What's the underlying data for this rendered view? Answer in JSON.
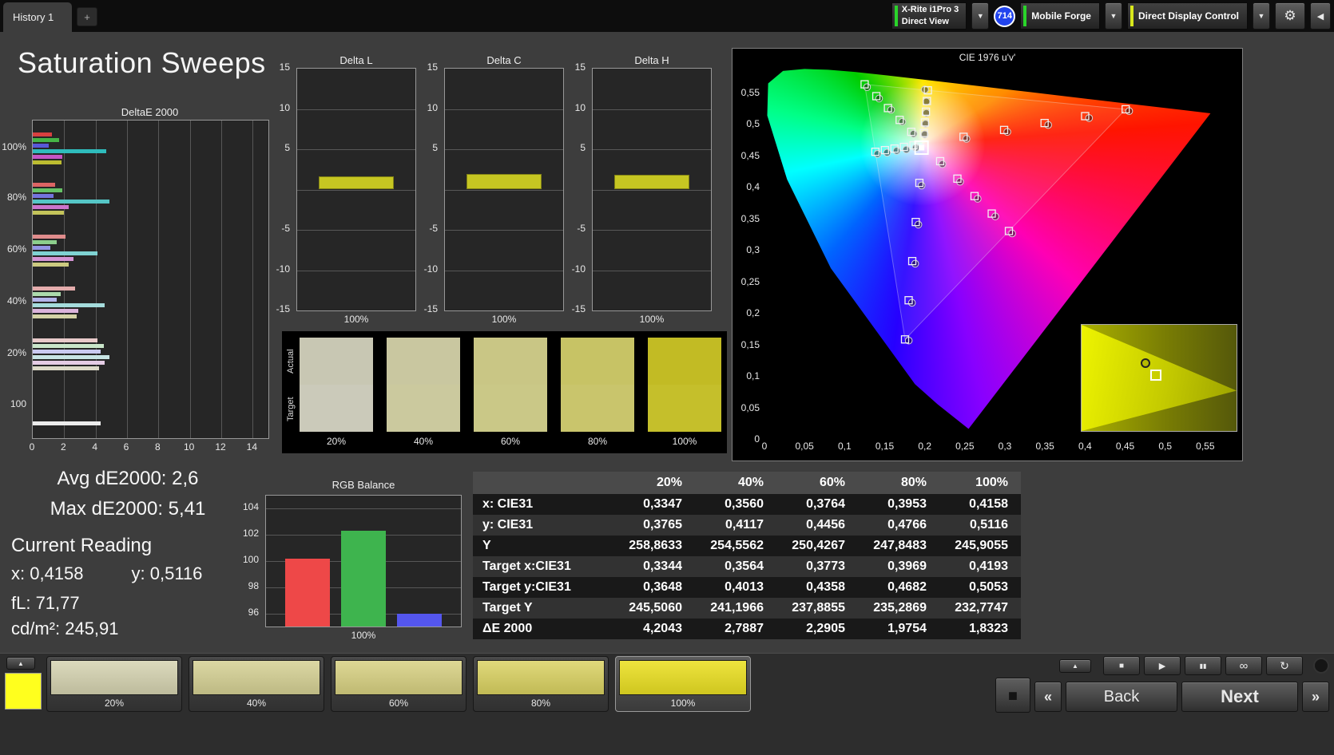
{
  "top_bar": {
    "tab_label": "History 1",
    "add_tab_label": "+",
    "dropdown_icon": "▼",
    "gear_icon": "⚙",
    "collapse_icon": "◀",
    "badge": "714",
    "meter_widget": {
      "line1": "X-Rite i1Pro 3",
      "line2": "Direct View",
      "accent": "#2ad42a"
    },
    "source_widget": {
      "label": "Mobile Forge",
      "accent": "#2ad42a"
    },
    "display_widget": {
      "label": "Direct Display Control",
      "accent": "#d8e81c"
    }
  },
  "page": {
    "title": "Saturation Sweeps"
  },
  "stats": {
    "avg": "Avg dE2000: 2,6",
    "max": "Max dE2000: 5,41",
    "current_heading": "Current Reading",
    "x": "x: 0,4158",
    "y": "y: 0,5116",
    "fl": "fL: 71,77",
    "cd": "cd/m²: 245,91"
  },
  "chart_data": {
    "deltae2000": {
      "type": "bar",
      "title": "DeltaE 2000",
      "orientation": "horizontal",
      "xlim": [
        0,
        15
      ],
      "xticks": [
        0,
        2,
        4,
        6,
        8,
        10,
        12,
        14
      ],
      "groups": [
        {
          "label": "100%",
          "bars": [
            [
              1.2,
              "#d84040"
            ],
            [
              1.7,
              "#46b446"
            ],
            [
              1.0,
              "#5858d8"
            ],
            [
              4.7,
              "#2fbcbc"
            ],
            [
              1.9,
              "#c455c4"
            ],
            [
              1.83,
              "#bcbc30"
            ]
          ]
        },
        {
          "label": "80%",
          "bars": [
            [
              1.4,
              "#dc6464"
            ],
            [
              1.9,
              "#66c266"
            ],
            [
              1.3,
              "#7474de"
            ],
            [
              4.9,
              "#55c6c6"
            ],
            [
              2.3,
              "#cc74cc"
            ],
            [
              1.98,
              "#c4c45a"
            ]
          ]
        },
        {
          "label": "60%",
          "bars": [
            [
              2.1,
              "#e08c8c"
            ],
            [
              1.5,
              "#8cce8c"
            ],
            [
              1.1,
              "#9494e4"
            ],
            [
              4.1,
              "#7fd2d2"
            ],
            [
              2.6,
              "#d494d4"
            ],
            [
              2.29,
              "#ccca80"
            ]
          ]
        },
        {
          "label": "40%",
          "bars": [
            [
              2.7,
              "#e4acac"
            ],
            [
              1.8,
              "#acdaac"
            ],
            [
              1.5,
              "#b4b4ea"
            ],
            [
              4.6,
              "#a5dcdc"
            ],
            [
              2.9,
              "#dcb4dc"
            ],
            [
              2.79,
              "#d4d2a6"
            ]
          ]
        },
        {
          "label": "20%",
          "bars": [
            [
              4.1,
              "#e8caca"
            ],
            [
              4.5,
              "#cae6ca"
            ],
            [
              4.3,
              "#cacaf0"
            ],
            [
              4.9,
              "#c8e4e4"
            ],
            [
              4.6,
              "#e4cce4"
            ],
            [
              4.2,
              "#dcdac8"
            ]
          ]
        },
        {
          "label": "100",
          "bars": [
            [
              4.3,
              "#ececec"
            ]
          ]
        }
      ]
    },
    "delta_l": {
      "type": "bar",
      "title": "Delta L",
      "categories": [
        "100%"
      ],
      "values": [
        1.6
      ],
      "color": "#c6c622",
      "ylim": [
        -15,
        15
      ],
      "yticks": [
        15,
        10,
        5,
        -5,
        -10,
        -15
      ],
      "xlabel": "100%"
    },
    "delta_c": {
      "type": "bar",
      "title": "Delta C",
      "categories": [
        "100%"
      ],
      "values": [
        1.9
      ],
      "color": "#c6c622",
      "ylim": [
        -15,
        15
      ],
      "yticks": [
        15,
        10,
        5,
        -5,
        -10,
        -15
      ],
      "xlabel": "100%"
    },
    "delta_h": {
      "type": "bar",
      "title": "Delta H",
      "categories": [
        "100%"
      ],
      "values": [
        1.8
      ],
      "color": "#c6c622",
      "ylim": [
        -15,
        15
      ],
      "yticks": [
        15,
        10,
        5,
        -5,
        -10,
        -15
      ],
      "xlabel": "100%"
    },
    "swatches": {
      "row_labels": [
        "Actual",
        "Target"
      ],
      "labels": [
        "20%",
        "40%",
        "60%",
        "80%",
        "100%"
      ],
      "actual": [
        "#c8c7b3",
        "#c9c7a0",
        "#c9c685",
        "#c7c365",
        "#c2bb24"
      ],
      "target": [
        "#cbcaba",
        "#cbc99e",
        "#cac887",
        "#c9c56c",
        "#c5bf2b"
      ]
    },
    "cie": {
      "type": "scatter",
      "title": "CIE 1976 u'v'",
      "ticks": [
        "0",
        "0,05",
        "0,1",
        "0,15",
        "0,2",
        "0,25",
        "0,3",
        "0,35",
        "0,4",
        "0,45",
        "0,5",
        "0,55"
      ],
      "tick_step": 0.05,
      "xlim": [
        0,
        0.588
      ],
      "ylim": [
        0,
        0.6
      ],
      "white_point": [
        0.1978,
        0.4683
      ],
      "gamut_triangle": [
        [
          0.4507,
          0.5229
        ],
        [
          0.125,
          0.5625
        ],
        [
          0.1754,
          0.1579
        ]
      ],
      "locus": [
        [
          0.5565,
          0.5165
        ],
        [
          0.52,
          0.522
        ],
        [
          0.4035,
          0.5393
        ],
        [
          0.3315,
          0.5501
        ],
        [
          0.2623,
          0.5604
        ],
        [
          0.2026,
          0.5693
        ],
        [
          0.1531,
          0.5766
        ],
        [
          0.1127,
          0.5821
        ],
        [
          0.0792,
          0.5856
        ],
        [
          0.05,
          0.5868
        ],
        [
          0.0231,
          0.5837
        ],
        [
          0.0046,
          0.5639
        ],
        [
          0.0035,
          0.5131
        ],
        [
          0.0282,
          0.4117
        ],
        [
          0.0828,
          0.2708
        ],
        [
          0.1877,
          0.0871
        ],
        [
          0.2161,
          0.0549
        ],
        [
          0.2546,
          0.0159
        ]
      ],
      "sweeps": [
        {
          "name": "red",
          "targets": [
            [
              0.2484,
              0.4792
            ],
            [
              0.299,
              0.4901
            ],
            [
              0.3495,
              0.5011
            ],
            [
              0.4001,
              0.512
            ],
            [
              0.4507,
              0.5229
            ]
          ],
          "measured": [
            [
              0.252,
              0.476
            ],
            [
              0.303,
              0.487
            ],
            [
              0.354,
              0.498
            ],
            [
              0.405,
              0.509
            ],
            [
              0.455,
              0.52
            ]
          ]
        },
        {
          "name": "green",
          "targets": [
            [
              0.1832,
              0.4871
            ],
            [
              0.1687,
              0.506
            ],
            [
              0.1541,
              0.5248
            ],
            [
              0.1396,
              0.5437
            ],
            [
              0.125,
              0.5625
            ]
          ],
          "measured": [
            [
              0.186,
              0.484
            ],
            [
              0.172,
              0.503
            ],
            [
              0.158,
              0.522
            ],
            [
              0.143,
              0.54
            ],
            [
              0.128,
              0.558
            ]
          ]
        },
        {
          "name": "blue",
          "targets": [
            [
              0.1933,
              0.4062
            ],
            [
              0.1888,
              0.3441
            ],
            [
              0.1844,
              0.2821
            ],
            [
              0.1799,
              0.22
            ],
            [
              0.1754,
              0.1579
            ]
          ],
          "measured": [
            [
              0.196,
              0.402
            ],
            [
              0.192,
              0.34
            ],
            [
              0.188,
              0.278
            ],
            [
              0.184,
              0.216
            ],
            [
              0.18,
              0.156
            ]
          ]
        },
        {
          "name": "cyan",
          "targets": [
            [
              0.1859,
              0.4657
            ],
            [
              0.174,
              0.4632
            ],
            [
              0.1622,
              0.4606
            ],
            [
              0.1503,
              0.4581
            ],
            [
              0.1384,
              0.4555
            ]
          ],
          "measured": [
            [
              0.189,
              0.462
            ],
            [
              0.177,
              0.459
            ],
            [
              0.165,
              0.457
            ],
            [
              0.153,
              0.454
            ],
            [
              0.141,
              0.452
            ]
          ]
        },
        {
          "name": "magenta",
          "targets": [
            [
              0.2192,
              0.4406
            ],
            [
              0.2407,
              0.4129
            ],
            [
              0.2621,
              0.3852
            ],
            [
              0.2836,
              0.3575
            ],
            [
              0.305,
              0.3298
            ]
          ],
          "measured": [
            [
              0.222,
              0.436
            ],
            [
              0.244,
              0.408
            ],
            [
              0.266,
              0.381
            ],
            [
              0.288,
              0.353
            ],
            [
              0.309,
              0.326
            ]
          ]
        },
        {
          "name": "yellow",
          "targets": [
            [
              0.199,
              0.4852
            ],
            [
              0.2002,
              0.5021
            ],
            [
              0.2015,
              0.5191
            ],
            [
              0.2027,
              0.536
            ],
            [
              0.2039,
              0.5529
            ]
          ],
          "measured": [
            [
              0.2,
              0.483
            ],
            [
              0.201,
              0.5
            ],
            [
              0.202,
              0.517
            ],
            [
              0.202,
              0.535
            ],
            [
              0.2002,
              0.5542
            ]
          ]
        }
      ],
      "highlight": [
        0.196,
        0.462
      ],
      "inset_markers": {
        "circle": [
          0.41,
          0.36
        ],
        "square": [
          0.48,
          0.47
        ]
      }
    },
    "rgb_balance": {
      "type": "bar",
      "title": "RGB Balance",
      "categories": [
        "Red",
        "Green",
        "Blue"
      ],
      "values": [
        100.2,
        102.3,
        96.0
      ],
      "colors": [
        "#ee4848",
        "#3eb44e",
        "#5456ee"
      ],
      "ylim": [
        95,
        105
      ],
      "yticks": [
        104,
        102,
        100,
        98,
        96
      ],
      "xlabel": "100%"
    },
    "table": {
      "type": "table",
      "columns": [
        "",
        "20%",
        "40%",
        "60%",
        "80%",
        "100%"
      ],
      "rows": [
        [
          "x: CIE31",
          "0,3347",
          "0,3560",
          "0,3764",
          "0,3953",
          "0,4158"
        ],
        [
          "y: CIE31",
          "0,3765",
          "0,4117",
          "0,4456",
          "0,4766",
          "0,5116"
        ],
        [
          "Y",
          "258,8633",
          "254,5562",
          "250,4267",
          "247,8483",
          "245,9055"
        ],
        [
          "Target x:CIE31",
          "0,3344",
          "0,3564",
          "0,3773",
          "0,3969",
          "0,4193"
        ],
        [
          "Target y:CIE31",
          "0,3648",
          "0,4013",
          "0,4358",
          "0,4682",
          "0,5053"
        ],
        [
          "Target Y",
          "245,5060",
          "241,1966",
          "237,8855",
          "235,2869",
          "232,7747"
        ],
        [
          "ΔE 2000",
          "4,2043",
          "2,7887",
          "2,2905",
          "1,9754",
          "1,8323"
        ]
      ]
    }
  },
  "dock": {
    "up_icon": "▲",
    "window_icon": "◼",
    "prev_icon": "«",
    "back_label": "Back",
    "next_label": "Next",
    "fwd_icon": "»",
    "current_swatch_color": "#ffff1e",
    "patches": [
      {
        "label": "20%",
        "c1": "#dcdabd",
        "c2": "#bdbb9c",
        "selected": false
      },
      {
        "label": "40%",
        "c1": "#dcd8a4",
        "c2": "#bdb983",
        "selected": false
      },
      {
        "label": "60%",
        "c1": "#ded895",
        "c2": "#bfb972",
        "selected": false
      },
      {
        "label": "80%",
        "c1": "#e0d97b",
        "c2": "#c1ba55",
        "selected": false
      },
      {
        "label": "100%",
        "c1": "#eee43e",
        "c2": "#cfc61f",
        "selected": true
      }
    ],
    "transport": [
      {
        "name": "stop-button",
        "glyph": "■",
        "size": 10
      },
      {
        "name": "play-button",
        "glyph": "▶",
        "size": 11
      },
      {
        "name": "pause-button",
        "glyph": "▮▮",
        "size": 8
      },
      {
        "name": "loop-button",
        "glyph": "∞",
        "size": 15
      },
      {
        "name": "refresh-button",
        "glyph": "↻",
        "size": 14
      }
    ]
  }
}
